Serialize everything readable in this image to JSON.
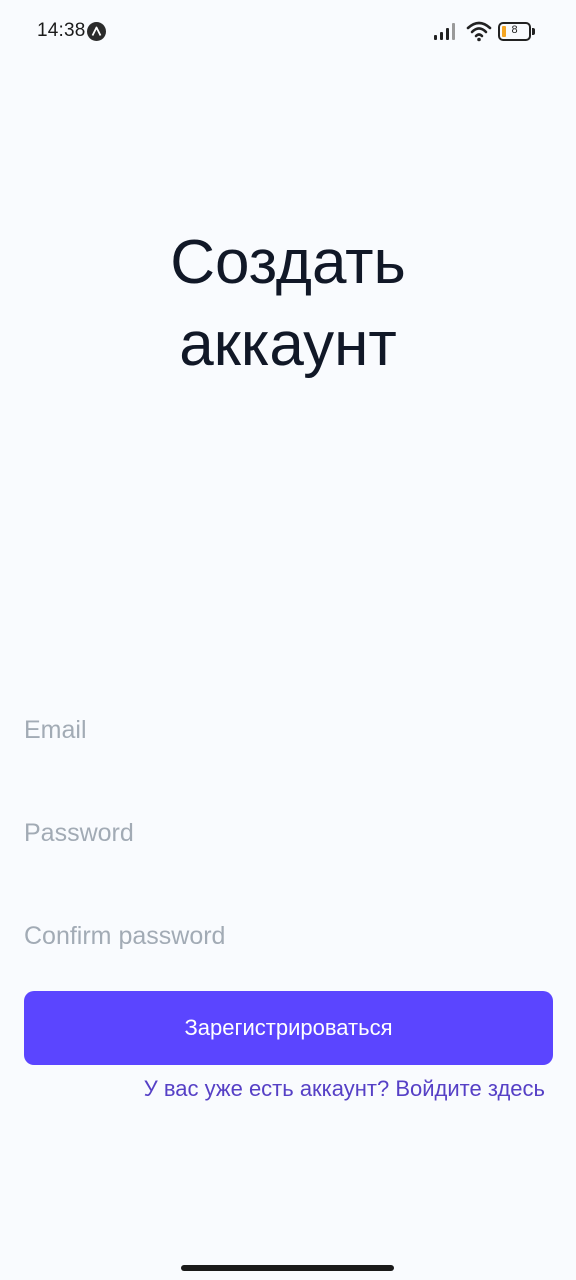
{
  "status_bar": {
    "time": "14:38",
    "battery_level": "8",
    "icons": [
      "app-notification-icon",
      "signal-icon",
      "wifi-icon",
      "battery-icon"
    ]
  },
  "title": "Создать\nаккаунт",
  "form": {
    "email_placeholder": "Email",
    "email_value": "",
    "password_placeholder": "Password",
    "password_value": "",
    "confirm_placeholder": "Confirm password",
    "confirm_value": "",
    "submit_label": "Зарегистрироваться",
    "login_link": "У вас уже есть аккаунт? Войдите здесь"
  },
  "colors": {
    "background": "#F9FBFE",
    "accent": "#5B45FF",
    "link": "#5640C6",
    "title": "#111827",
    "placeholder": "#A2ABB5"
  }
}
